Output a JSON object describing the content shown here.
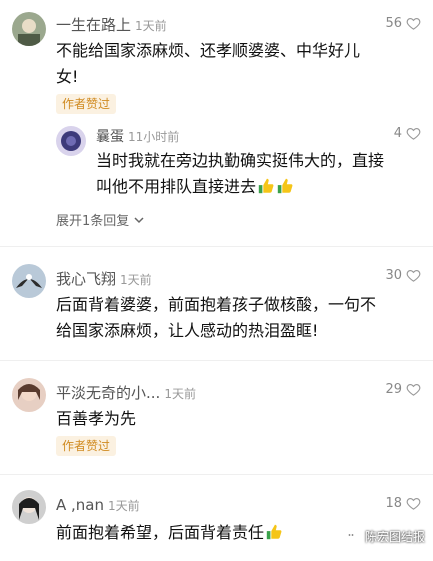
{
  "comments": [
    {
      "username": "一生在路上",
      "time": "1天前",
      "likes": "56",
      "text": [
        "不能给国家添麻烦、还孝顺婆婆、中华好儿",
        "女!"
      ],
      "badge": "作者赞过",
      "reply": {
        "username": "曩蛋",
        "time": "11小时前",
        "likes": "4",
        "text": [
          "当时我就在旁边执勤确实挺伟大的，直接",
          "叫他不用排队直接进去"
        ]
      },
      "expand": "展开1条回复"
    },
    {
      "username": "我心飞翔",
      "time": "1天前",
      "likes": "30",
      "text": [
        "后面背着婆婆，前面抱着孩子做核酸，一句不",
        "给国家添麻烦，让人感动的热泪盈眶!"
      ]
    },
    {
      "username": "平淡无奇的小...",
      "time": "1天前",
      "likes": "29",
      "text": [
        "百善孝为先"
      ],
      "badge": "作者赞过"
    },
    {
      "username": "A ,nan",
      "time": "1天前",
      "likes": "18",
      "text": [
        "前面抱着希望，后面背着责任"
      ]
    }
  ],
  "watermark": "陈宏图结报",
  "icons": {
    "like": "heart-outline-icon",
    "thumb": "thumbs-up-emoji",
    "chevron": "chevron-down-icon"
  }
}
